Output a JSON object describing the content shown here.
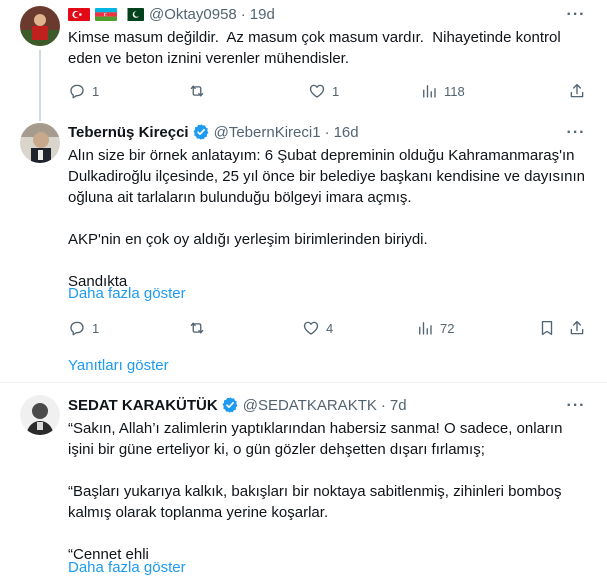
{
  "tweet1": {
    "handle": "@Oktay0958",
    "dot": "·",
    "time": "19d",
    "text": "Kimse masum değildir.  Az masum çok masum vardır.  Nihayetinde kontrol eden ve beton iznini verenler mühendisler.",
    "actions": {
      "reply": "1",
      "retweet": "",
      "like": "1",
      "views": "118"
    },
    "flags": [
      "turkey-flag",
      "azerbaijan-flag",
      "pakistan-flag"
    ]
  },
  "tweet2": {
    "name": "Tebernüş Kireçci",
    "handle": "@TebernKireci1",
    "dot": "·",
    "time": "16d",
    "text_p1": "Alın size bir örnek anlatayım: 6 Şubat depreminin olduğu Kahramanmaraş'ın Dulkadiroğlu ilçesinde, 25 yıl önce bir belediye başkanı kendisine ve dayısının oğluna ait tarlaların bulunduğu bölgeyi imara açmış.",
    "text_p2": "AKP'nin en çok oy aldığı yerleşim birimlerinden biriydi.",
    "text_p3": "Sandıkta",
    "show_more": "Daha fazla göster",
    "actions": {
      "reply": "1",
      "retweet": "",
      "like": "4",
      "views": "72"
    },
    "show_replies": "Yanıtları göster"
  },
  "tweet3": {
    "name": "SEDAT KARAKÜTÜK",
    "handle": "@SEDATKARAKTK",
    "dot": "·",
    "time": "7d",
    "text_p1": "“Sakın, Allah’ı zalimlerin yaptıklarından habersiz sanma! O sadece, onların işini bir güne erteliyor ki, o gün gözler dehşetten dışarı fırlamış;",
    "text_p2": "“Başları yukarıya kalkık, bakışları bir noktaya sabitlenmiş, zihinleri bomboş kalmış olarak toplanma yerine koşarlar.",
    "text_p3": "“Cennet ehli",
    "show_more": "Daha fazla göster"
  },
  "colors": {
    "accent": "#1d9bf0",
    "muted": "#536471",
    "text": "#0f1419",
    "line": "#cfd9de"
  }
}
